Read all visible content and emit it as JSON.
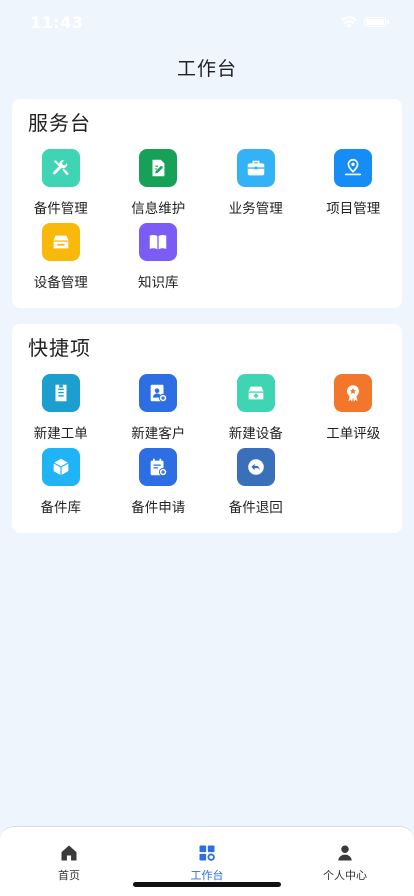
{
  "status_bar": {
    "time": "11:43",
    "wifi_icon": "wifi-icon",
    "battery_icon": "battery-icon"
  },
  "header": {
    "title": "工作台"
  },
  "service_desk": {
    "title": "服务台",
    "items": [
      {
        "label": "备件管理",
        "icon": "tools-icon",
        "color": "#3ed4b4"
      },
      {
        "label": "信息维护",
        "icon": "note-edit-icon",
        "color": "#17a058"
      },
      {
        "label": "业务管理",
        "icon": "briefcase-icon",
        "color": "#33b3f5"
      },
      {
        "label": "项目管理",
        "icon": "location-pin-icon",
        "color": "#168df5"
      },
      {
        "label": "设备管理",
        "icon": "device-box-icon",
        "color": "#f9b90b"
      },
      {
        "label": "知识库",
        "icon": "book-icon",
        "color": "#7b5cf5"
      }
    ]
  },
  "shortcuts": {
    "title": "快捷项",
    "items": [
      {
        "label": "新建工单",
        "icon": "document-list-icon",
        "color": "#1c9fcf"
      },
      {
        "label": "新建客户",
        "icon": "add-contact-icon",
        "color": "#2d6fe2"
      },
      {
        "label": "新建设备",
        "icon": "add-device-icon",
        "color": "#3ed4b4"
      },
      {
        "label": "工单评级",
        "icon": "badge-star-icon",
        "color": "#f2772a"
      },
      {
        "label": "备件库",
        "icon": "cube-icon",
        "color": "#1fb4f5"
      },
      {
        "label": "备件申请",
        "icon": "calendar-add-icon",
        "color": "#2d6fe2"
      },
      {
        "label": "备件退回",
        "icon": "return-arrow-icon",
        "color": "#3a6fb9"
      }
    ]
  },
  "tab_bar": {
    "active_color": "#2d6fe2",
    "inactive_color": "#3a3a3a",
    "tabs": [
      {
        "label": "首页",
        "icon": "home-icon",
        "active": false
      },
      {
        "label": "工作台",
        "icon": "workbench-grid-icon",
        "active": true
      },
      {
        "label": "个人中心",
        "icon": "user-icon",
        "active": false
      }
    ]
  }
}
